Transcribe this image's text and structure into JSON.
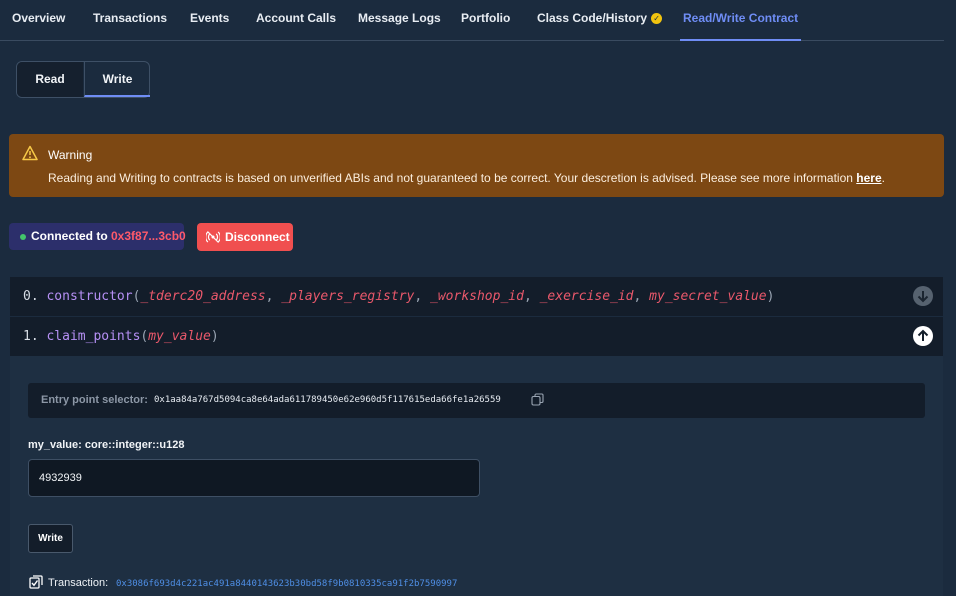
{
  "nav": {
    "tabs": [
      {
        "label": "Overview"
      },
      {
        "label": "Transactions"
      },
      {
        "label": "Events"
      },
      {
        "label": "Account Calls"
      },
      {
        "label": "Message Logs"
      },
      {
        "label": "Portfolio"
      },
      {
        "label": "Class Code/History"
      },
      {
        "label": "Read/Write Contract"
      }
    ],
    "active_tab": "Read/Write Contract",
    "verified_icon": "check-circle-icon"
  },
  "mode": {
    "read_label": "Read",
    "write_label": "Write",
    "selected": "Write"
  },
  "warning": {
    "title": "Warning",
    "text": "Reading and Writing to contracts is based on unverified ABIs and not guaranteed to be correct. Your descretion is advised. Please see more information ",
    "link_label": "here",
    "text_end": "."
  },
  "wallet": {
    "connected_prefix": "Connected to ",
    "address": "0x3f87...3cb0",
    "disconnect_label": "Disconnect"
  },
  "functions": [
    {
      "index": "0.",
      "name": "constructor",
      "open": "(",
      "params": [
        "_tderc20_address",
        "_players_registry",
        "_workshop_id",
        "_exercise_id",
        "my_secret_value"
      ],
      "separator": ", ",
      "close": ")",
      "expanded": false
    },
    {
      "index": "1.",
      "name": "claim_points",
      "open": "(",
      "params": [
        "my_value"
      ],
      "separator": ", ",
      "close": ")",
      "expanded": true
    }
  ],
  "claim_points_panel": {
    "selector_label": "Entry point selector:",
    "selector_value": "0x1aa84a767d5094ca8e64ada611789450e62e960d5f117615eda66fe1a26559",
    "input_label": "my_value: core::integer::u128",
    "input_value": "4932939",
    "write_button": "Write",
    "transaction_label": "Transaction:",
    "transaction_hash": "0x3086f693d4c221ac491a8440143623b30bd58f9b0810335ca91f2b7590997"
  },
  "colors": {
    "background": "#1b2b3e",
    "accent": "#6f8df5",
    "warning": "#7d4813",
    "danger": "#f04f4f",
    "connected": "#2c2f6b",
    "param": "#e9586b",
    "function": "#b690f5",
    "link": "#4f8fe6"
  }
}
